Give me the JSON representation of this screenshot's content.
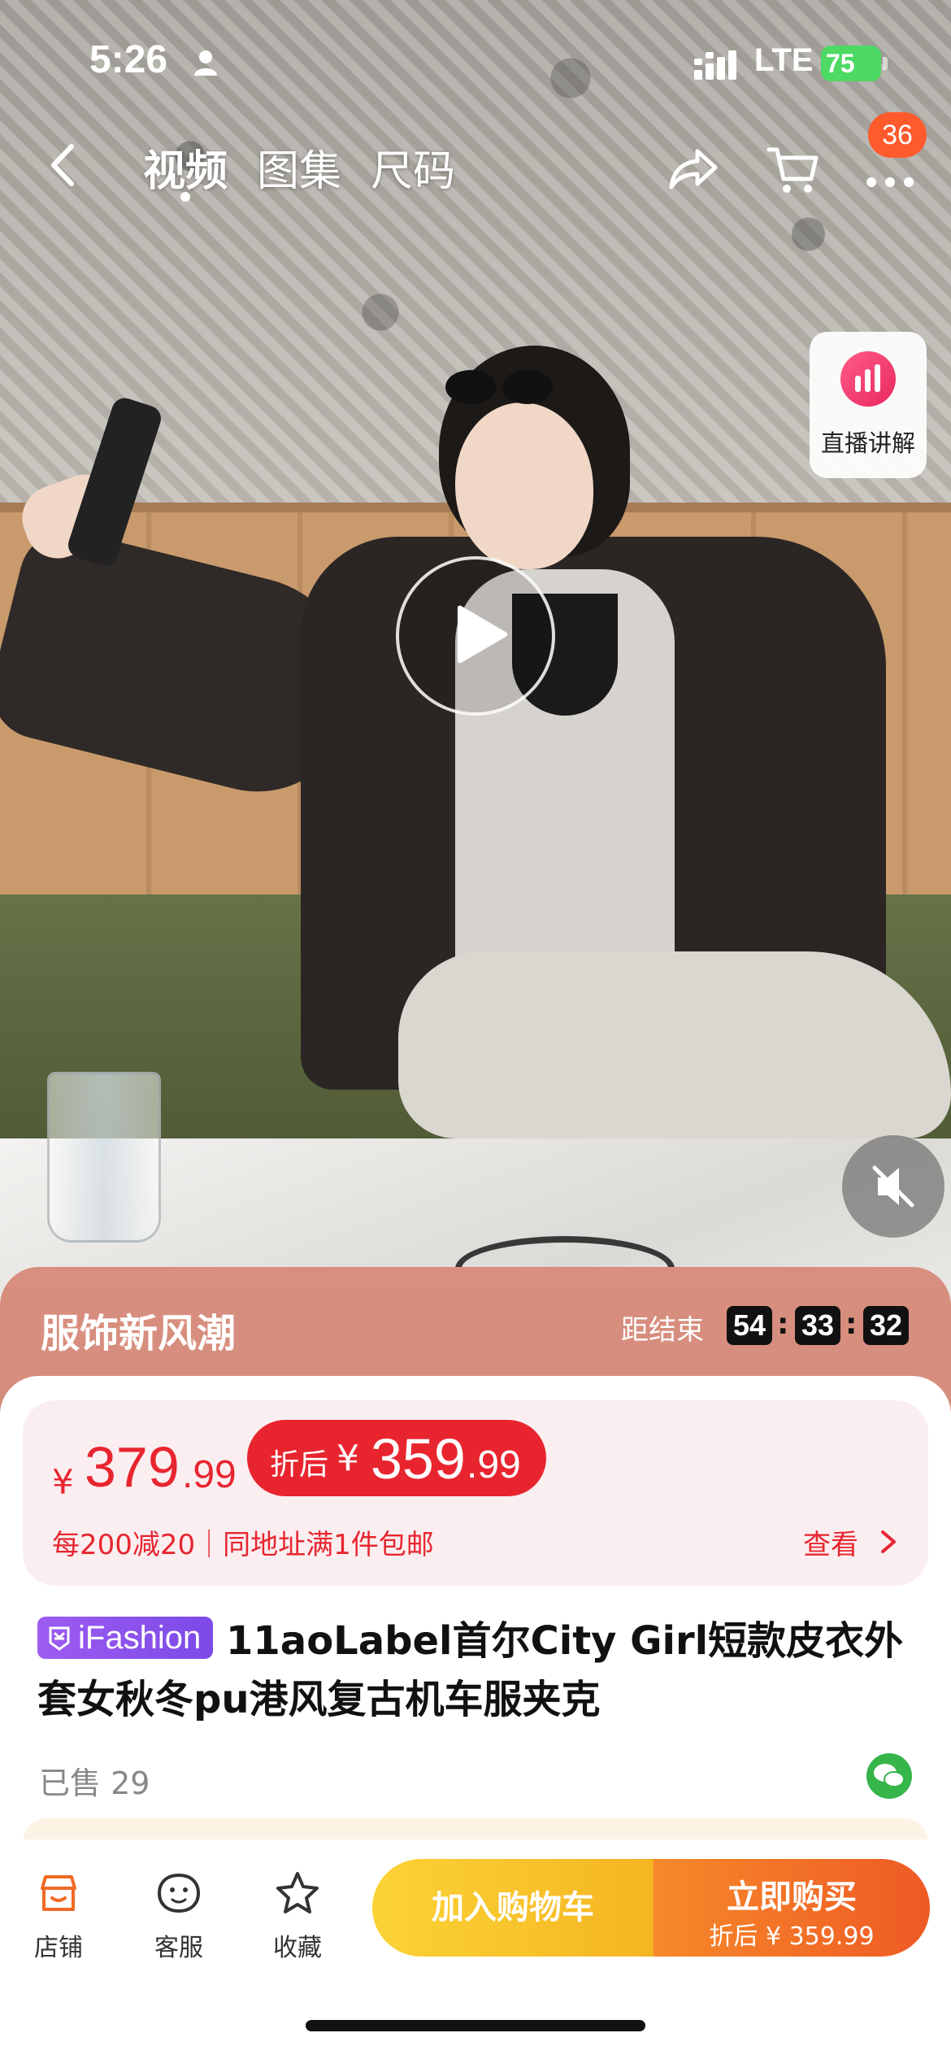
{
  "status_bar": {
    "time": "5:26",
    "network": "LTE",
    "battery": "75"
  },
  "nav": {
    "tabs": [
      "视频",
      "图集",
      "尺码"
    ],
    "active_tab": "视频",
    "more_badge": "36"
  },
  "live_explain": {
    "label": "直播讲解"
  },
  "promo": {
    "title": "服饰新风潮",
    "ends_label": "距结束",
    "countdown": [
      "54",
      "33",
      "32"
    ]
  },
  "price": {
    "currency": "¥",
    "original_int": "379",
    "original_dec": ".99",
    "after_label": "折后",
    "after_int": "359",
    "after_dec": ".99",
    "rules": "每200减20｜同地址满1件包邮",
    "view_label": "查看"
  },
  "product": {
    "brand_tag": "iFashion",
    "title": "11aoLabel首尔City Girl短款皮衣外套女秋冬pu港风复古机车服夹克",
    "sold": "已售 29"
  },
  "bottom_bar": {
    "store": "店铺",
    "service": "客服",
    "favorite": "收藏",
    "add_to_cart": "加入购物车",
    "buy_now": "立即购买",
    "buy_now_sub": "折后 ¥ 359.99"
  },
  "colors": {
    "accent_red": "#e8252f",
    "cart_yellow": "#f5b522",
    "buy_orange": "#ee5a24",
    "promo_banner": "#d98f7f",
    "brand_purple": "#8b52ee"
  }
}
